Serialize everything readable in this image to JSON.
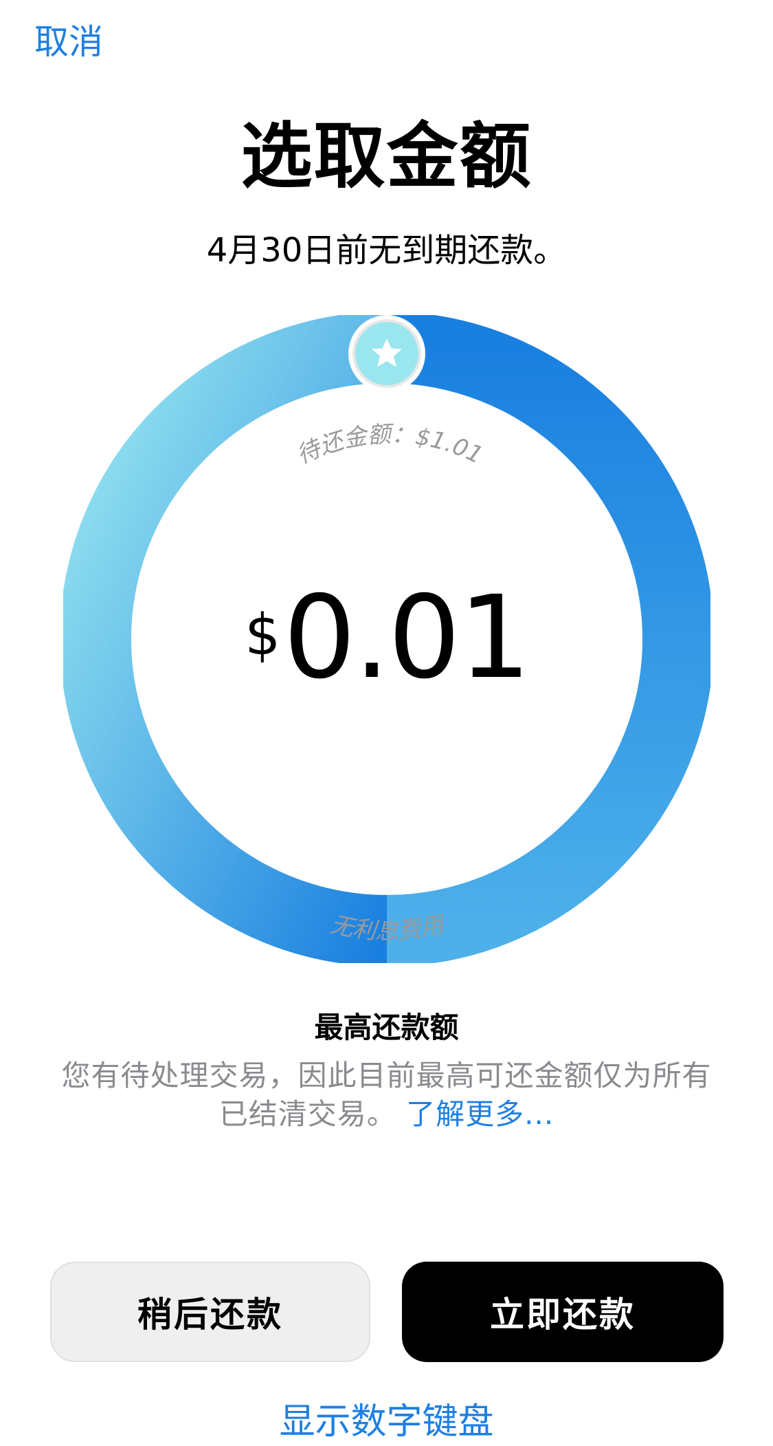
{
  "header": {
    "cancel_label": "取消"
  },
  "main": {
    "title": "选取金额",
    "subtitle": "4月30日前无到期还款。"
  },
  "dial": {
    "top_label": "待还金额：$1.01",
    "bottom_label": "无利息费用",
    "currency_symbol": "$",
    "amount": "0.01",
    "selected_fraction": 0.0099,
    "handle_icon": "star-icon",
    "colors": {
      "gradient_start": "#9ae8f0",
      "gradient_end": "#1a80e0",
      "handle_fill": "#9ae6ef"
    }
  },
  "info": {
    "title": "最高还款额",
    "body": "您有待处理交易，因此目前最高可还金额仅为所有已结清交易。",
    "link": "了解更多..."
  },
  "actions": {
    "later_label": "稍后还款",
    "now_label": "立即还款",
    "keypad_label": "显示数字键盘"
  },
  "colors": {
    "accent": "#1e7fe3",
    "secondary_text": "#8a8a8f"
  }
}
